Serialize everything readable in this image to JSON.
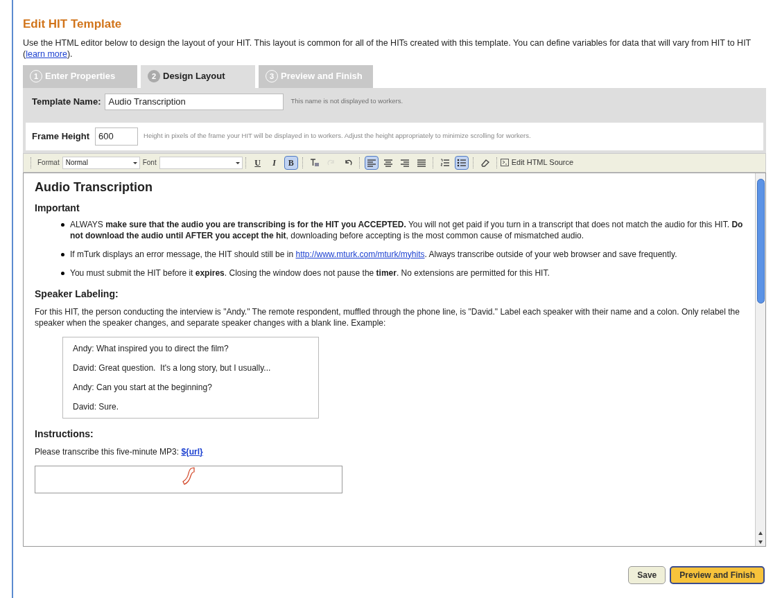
{
  "title": "Edit HIT Template",
  "intro": {
    "before": "Use the HTML editor below to design the layout of your HIT. This layout is common for all of the HITs created with this template. You can define variables for data that will vary from HIT to HIT (",
    "link": "learn more",
    "after": ")."
  },
  "tabs": [
    {
      "number": "1",
      "label": "Enter Properties",
      "selected": false
    },
    {
      "number": "2",
      "label": "Design Layout",
      "selected": true
    },
    {
      "number": "3",
      "label": "Preview and Finish",
      "selected": false
    }
  ],
  "template_name": {
    "label": "Template Name:",
    "value": "Audio Transcription",
    "hint": "This name is not displayed to workers."
  },
  "frame_height": {
    "label": "Frame Height",
    "value": "600",
    "hint": "Height in pixels of the frame your HIT will be displayed in to workers. Adjust the height appropriately to minimize scrolling for workers."
  },
  "toolbar": {
    "format_label": "Format",
    "format_value": "Normal",
    "font_label": "Font",
    "buttons": [
      {
        "label": "U",
        "on": false
      },
      {
        "label": "I",
        "on": false
      },
      {
        "label": "B",
        "on": true
      }
    ],
    "icon_buttons": [
      {
        "on": false,
        "disabled": false
      },
      {
        "on": false,
        "disabled": true
      },
      {
        "on": false,
        "disabled": false
      },
      {
        "on": true,
        "disabled": false
      },
      {
        "on": false,
        "disabled": false
      },
      {
        "on": false,
        "disabled": false
      },
      {
        "on": false,
        "disabled": false
      },
      {
        "on": false,
        "disabled": false
      },
      {
        "on": true,
        "disabled": false
      },
      {
        "on": false,
        "disabled": false
      }
    ],
    "source_label": "Edit HTML Source"
  },
  "document": {
    "heading": "Audio Transcription",
    "important": "Important",
    "bullets": [
      {
        "text": "ALWAYS **make sure that the audio you are transcribing is for the HIT you ACCEPTED.** You will not get paid if you turn in a transcript that does not match the audio for this HIT. **Do not download the audio until AFTER you accept the hit**, downloading before accepting is the most common cause of mismatched audio."
      },
      {
        "text": "If mTurk displays an error message, the HIT should still be in ",
        "link": "http://www.mturk.com/mturk/myhits",
        "after": ". Always transcribe outside of your web browser and save frequently."
      },
      {
        "text": "You must submit the HIT before it **expires**. Closing the window does not pause the **timer**. No extensions are permitted for this HIT."
      }
    ],
    "speaker_heading": "Speaker Labeling:",
    "speaker_text": "For this HIT, the person conducting the interview is \"Andy.\" The remote respondent, muffled through the phone line, is \"David.\" Label each speaker with their name and a colon. Only relabel the speaker when the speaker changes, and separate speaker changes with a blank line. Example:",
    "example": [
      "Andy: What inspired you to direct the film?",
      "David: Great question.  It's a long story, but I usually...",
      "Andy: Can you start at the beginning?",
      "David: Sure."
    ],
    "instructions_heading": "Instructions:",
    "instructions_text": "Please transcribe this five-minute MP3: ",
    "instructions_link": "${url}"
  },
  "buttons": [
    {
      "label": "Save",
      "kind": "secondary"
    },
    {
      "label": "Preview and Finish",
      "kind": "primary"
    }
  ]
}
